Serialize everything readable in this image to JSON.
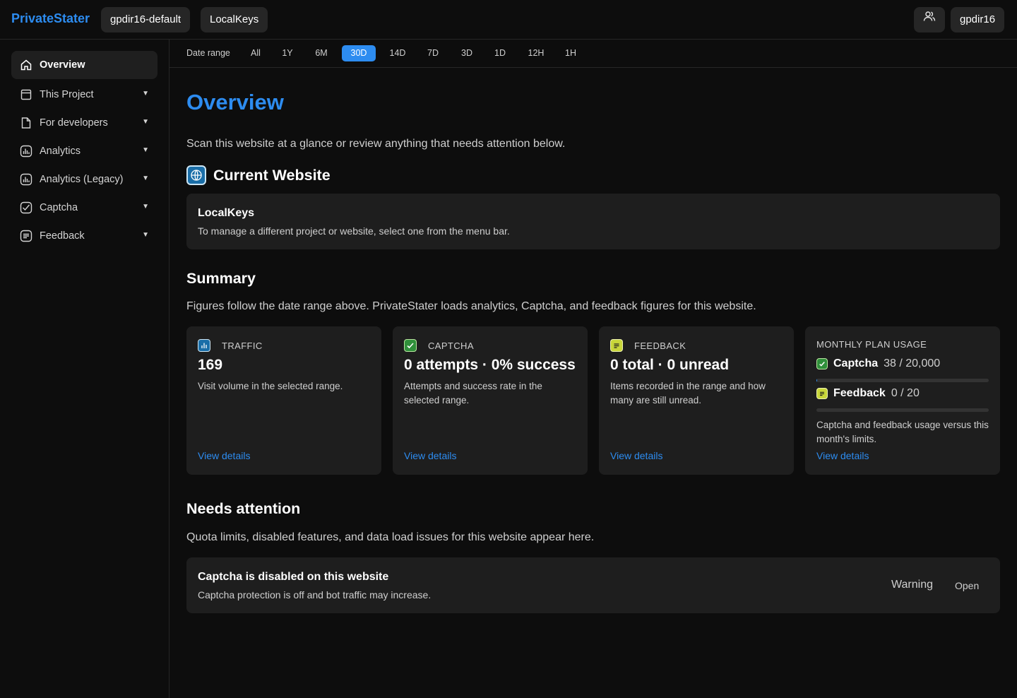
{
  "app": {
    "brand": "PrivateStater",
    "project_selector": "gpdir16-default",
    "website_selector": "LocalKeys",
    "user_label": "gpdir16",
    "users_icon": "users-icon"
  },
  "sidebar": {
    "items": [
      {
        "label": "Overview",
        "icon": "home-icon",
        "active": true
      },
      {
        "label": "This Project",
        "icon": "window-icon",
        "caret": "▼"
      },
      {
        "label": "For developers",
        "icon": "file-icon",
        "caret": "▼"
      },
      {
        "label": "Analytics",
        "icon": "bar-chart-icon",
        "caret": "▼"
      },
      {
        "label": "Analytics (Legacy)",
        "icon": "bar-chart-icon",
        "caret": "▼"
      },
      {
        "label": "Captcha",
        "icon": "check-box-icon",
        "caret": "▼"
      },
      {
        "label": "Feedback",
        "icon": "message-lines-icon",
        "caret": "▼"
      }
    ]
  },
  "date_range": {
    "label": "Date range",
    "options": [
      "All",
      "1Y",
      "6M",
      "30D",
      "14D",
      "7D",
      "3D",
      "1D",
      "12H",
      "1H"
    ],
    "selected": "30D"
  },
  "main": {
    "title": "Overview",
    "intro": "Scan this website at a glance or review anything that needs attention below.",
    "current_website": {
      "heading": "Current Website",
      "name": "LocalKeys",
      "description": "To manage a different project or website, select one from the menu bar."
    },
    "summary": {
      "heading": "Summary",
      "description": "Figures follow the date range above. PrivateStater loads analytics, Captcha, and feedback figures for this website.",
      "cards": [
        {
          "label": "TRAFFIC",
          "value": "169",
          "description": "Visit volume in the selected range.",
          "link": "View details"
        },
        {
          "label": "CAPTCHA",
          "value": "0 attempts · 0% success",
          "description": "Attempts and success rate in the selected range.",
          "link": "View details"
        },
        {
          "label": "FEEDBACK",
          "value": "0 total · 0 unread",
          "description": "Items recorded in the range and how many are still unread.",
          "link": "View details"
        }
      ],
      "usage": {
        "label": "MONTHLY PLAN USAGE",
        "captcha_label": "Captcha",
        "captcha_value": "38 / 20,000",
        "captcha_fraction": 0.0019,
        "feedback_label": "Feedback",
        "feedback_value": "0 / 20",
        "feedback_fraction": 0,
        "description": "Captcha and feedback usage versus this month's limits.",
        "link": "View details"
      }
    },
    "needs_attention": {
      "heading": "Needs attention",
      "description": "Quota limits, disabled features, and data load issues for this website appear here.",
      "alerts": [
        {
          "title": "Captcha is disabled on this website",
          "description": "Captcha protection is off and bot traffic may increase.",
          "level": "Warning",
          "action": "Open"
        }
      ]
    }
  },
  "colors": {
    "accent": "#2d8cf0",
    "background": "#0d0d0d",
    "card": "#1e1e1e",
    "captcha_icon": "#2f8f3a",
    "feedback_icon": "#c8d63a"
  }
}
